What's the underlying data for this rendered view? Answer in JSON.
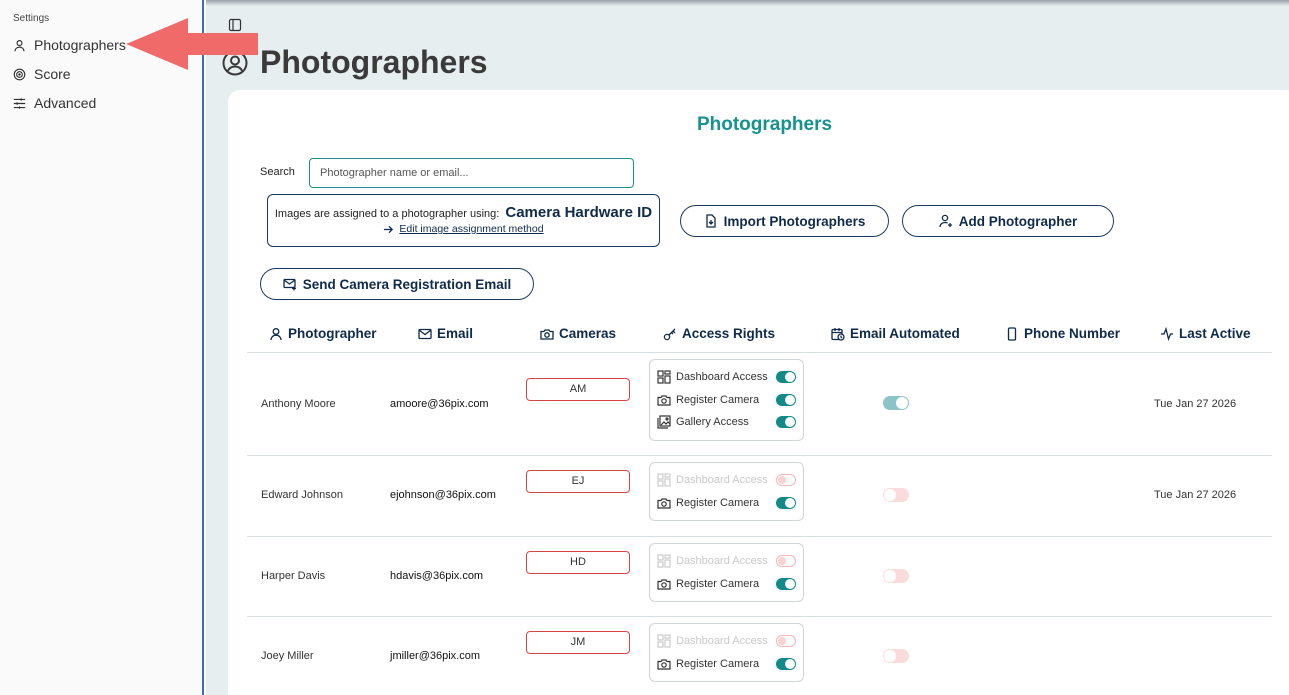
{
  "sidebar": {
    "section_label": "Settings",
    "items": [
      {
        "label": "Photographers",
        "icon": "user-icon"
      },
      {
        "label": "Score",
        "icon": "target-icon"
      },
      {
        "label": "Advanced",
        "icon": "sliders-icon"
      }
    ]
  },
  "page": {
    "title": "Photographers",
    "card_title": "Photographers"
  },
  "search": {
    "label": "Search",
    "placeholder": "Photographer name or email..."
  },
  "assignment": {
    "prefix": "Images are assigned to a photographer using:",
    "method": "Camera Hardware ID",
    "edit_link": "Edit image assignment method"
  },
  "buttons": {
    "import": "Import Photographers",
    "add": "Add Photographer",
    "send_email": "Send Camera Registration Email"
  },
  "table": {
    "headers": {
      "photographer": "Photographer",
      "email": "Email",
      "cameras": "Cameras",
      "access": "Access Rights",
      "email_automated": "Email Automated",
      "phone": "Phone Number",
      "last_active": "Last Active"
    },
    "access_labels": {
      "dashboard": "Dashboard Access",
      "register": "Register Camera",
      "gallery": "Gallery Access"
    },
    "rows": [
      {
        "name": "Anthony Moore",
        "email": "amoore@36pix.com",
        "camera": "AM",
        "dashboard": true,
        "register": true,
        "gallery": true,
        "email_automated": true,
        "last_active": "Tue Jan 27 2026"
      },
      {
        "name": "Edward Johnson",
        "email": "ejohnson@36pix.com",
        "camera": "EJ",
        "dashboard": false,
        "register": true,
        "email_automated": false,
        "last_active": "Tue Jan 27 2026"
      },
      {
        "name": "Harper Davis",
        "email": "hdavis@36pix.com",
        "camera": "HD",
        "dashboard": false,
        "register": true,
        "email_automated": false,
        "last_active": ""
      },
      {
        "name": "Joey Miller",
        "email": "jmiller@36pix.com",
        "camera": "JM",
        "dashboard": false,
        "register": true,
        "email_automated": false,
        "last_active": ""
      }
    ]
  },
  "colors": {
    "accent": "#16928f",
    "navy": "#0f2a4a",
    "annotation_arrow": "#f06a6a",
    "camera_border": "#d64545"
  }
}
